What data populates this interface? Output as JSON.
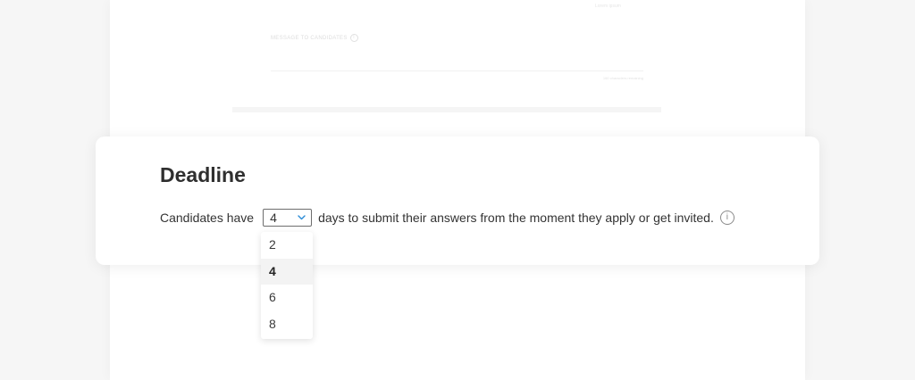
{
  "background": {
    "top_hint": "Lorem ipsum",
    "message_label": "MESSAGE TO CANDIDATES",
    "chars_remaining": "160 characters remaining"
  },
  "deadline": {
    "title": "Deadline",
    "prefix": "Candidates have",
    "selected_value": "4",
    "suffix": "days to submit their answers from the moment they apply or get invited.",
    "info_glyph": "i",
    "options": [
      "2",
      "4",
      "6",
      "8"
    ],
    "selected_index": 1
  },
  "colors": {
    "card_bg": "#ffffff",
    "page_bg": "#f6f6f6",
    "chevron": "#2a8bd6"
  },
  "icons": {
    "chevron": "chevron-down-icon",
    "info": "info-icon"
  }
}
